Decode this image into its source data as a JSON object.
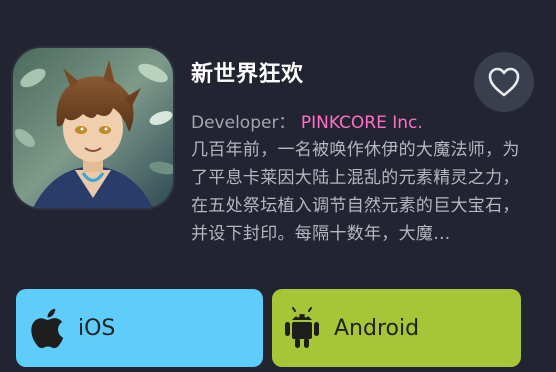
{
  "app": {
    "title": "新世界狂欢",
    "developer_label": "Developer：",
    "developer_name": "PINKCORE Inc.",
    "description": "几百年前，一名被唤作休伊的大魔法师，为了平息卡莱因大陆上混乱的元素精灵之力，在五处祭坛植入调节自然元素的巨大宝石，并设下封印。每隔十数年，大魔…"
  },
  "buttons": {
    "ios_label": "iOS",
    "android_label": "Android"
  },
  "colors": {
    "background": "#222531",
    "developer_name": "#ff6ec7",
    "ios_button": "#5ecdfc",
    "android_button": "#a6c638",
    "favorite_button": "#3a3f4d"
  },
  "icons": {
    "favorite": "heart-outline-icon",
    "ios": "apple-icon",
    "android": "android-robot-icon"
  }
}
